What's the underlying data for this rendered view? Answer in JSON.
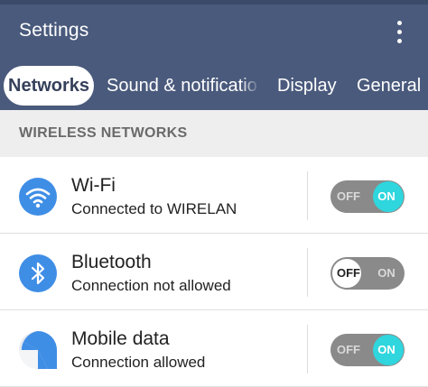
{
  "appbar": {
    "title": "Settings",
    "menu_icon": "more-vertical-icon",
    "background": "#4a5a7c"
  },
  "tabs": [
    {
      "label": "Networks",
      "active": true
    },
    {
      "label": "Sound & notifications",
      "active": false
    },
    {
      "label": "Display",
      "active": false
    },
    {
      "label": "General",
      "active": false
    }
  ],
  "section": {
    "header": "WIRELESS NETWORKS"
  },
  "rows": [
    {
      "icon": "wifi-icon",
      "title": "Wi-Fi",
      "subtitle": "Connected to WIRELAN",
      "toggle": {
        "off_label": "OFF",
        "on_label": "ON",
        "state": "on"
      }
    },
    {
      "icon": "bluetooth-icon",
      "title": "Bluetooth",
      "subtitle": "Connection not allowed",
      "toggle": {
        "off_label": "OFF",
        "on_label": "ON",
        "state": "off"
      }
    },
    {
      "icon": "mobile-data-icon",
      "title": "Mobile data",
      "subtitle": "Connection allowed",
      "toggle": {
        "off_label": "OFF",
        "on_label": "ON",
        "state": "on"
      }
    }
  ],
  "colors": {
    "toggle_on": "#2fd6dd",
    "icon_blue": "#3f8ee6"
  }
}
